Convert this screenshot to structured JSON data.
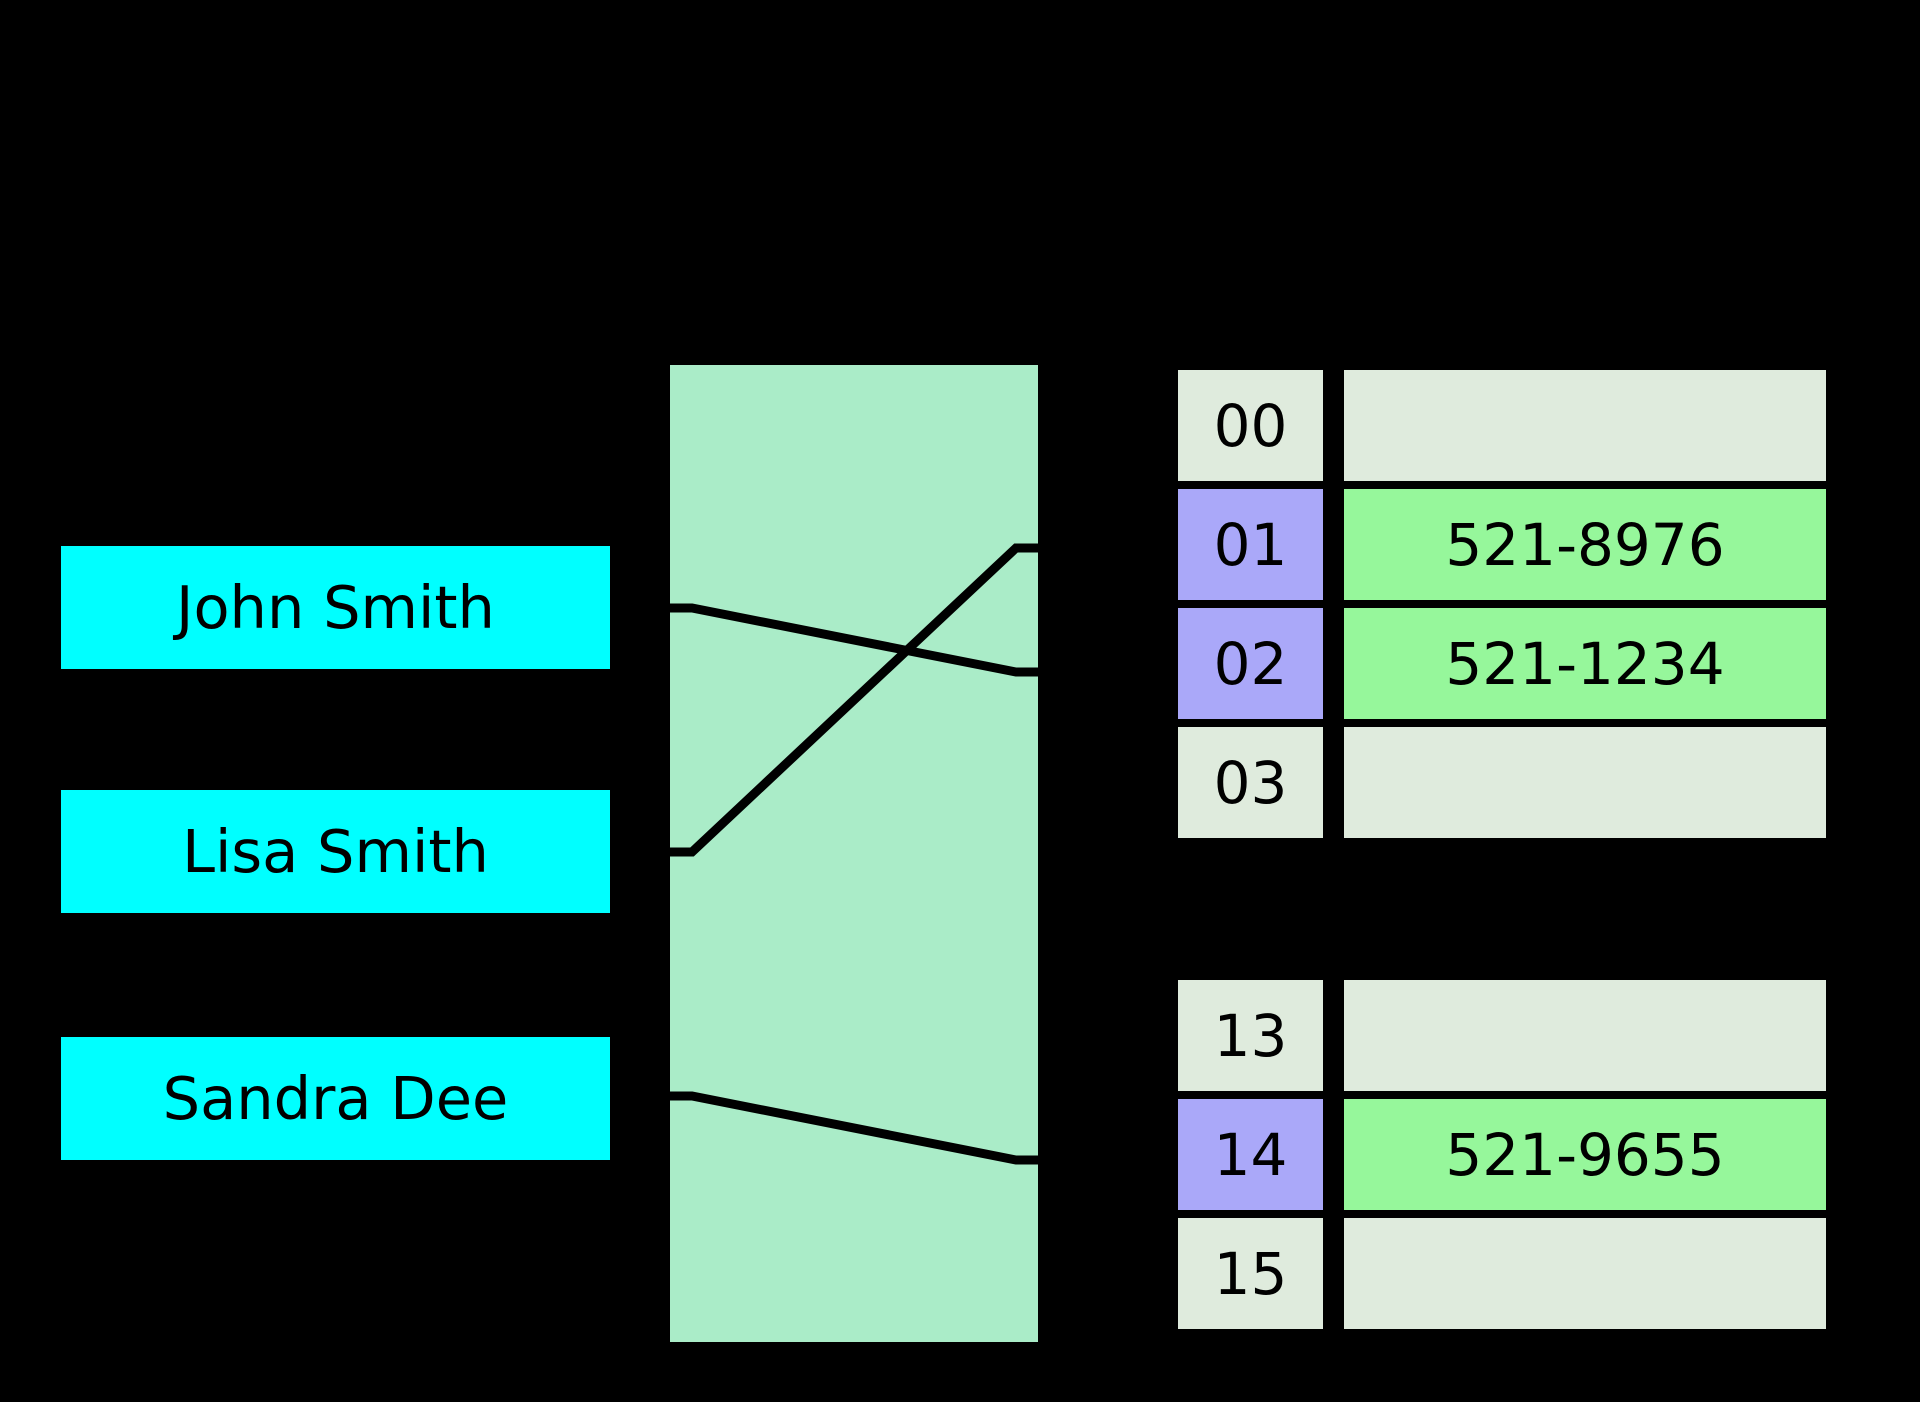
{
  "diagram": {
    "title": "hash-table-diagram",
    "colors": {
      "background": "#000000",
      "key_box": "#00ffff",
      "hash_panel": "#aaecc8",
      "bucket_index_empty": "#dfebdd",
      "bucket_value_empty": "#dfebdd",
      "bucket_index_filled": "#aaa8f9",
      "bucket_value_filled": "#96f79b",
      "line": "#000000",
      "text": "#000000"
    }
  },
  "keys": [
    {
      "label": "John Smith",
      "name": "key-john"
    },
    {
      "label": "Lisa Smith",
      "name": "key-lisa"
    },
    {
      "label": "Sandra Dee",
      "name": "key-sandra"
    }
  ],
  "hash_function": {
    "label": "",
    "mappings": [
      {
        "from_key": "John Smith",
        "to_bucket": "02"
      },
      {
        "from_key": "Lisa Smith",
        "to_bucket": "01"
      },
      {
        "from_key": "Sandra Dee",
        "to_bucket": "14"
      }
    ]
  },
  "buckets": {
    "upper": [
      {
        "index": "00",
        "value": "",
        "filled": false
      },
      {
        "index": "01",
        "value": "521-8976",
        "filled": true
      },
      {
        "index": "02",
        "value": "521-1234",
        "filled": true
      },
      {
        "index": "03",
        "value": "",
        "filled": false
      }
    ],
    "lower": [
      {
        "index": "13",
        "value": "",
        "filled": false
      },
      {
        "index": "14",
        "value": "521-9655",
        "filled": true
      },
      {
        "index": "15",
        "value": "",
        "filled": false
      }
    ]
  }
}
